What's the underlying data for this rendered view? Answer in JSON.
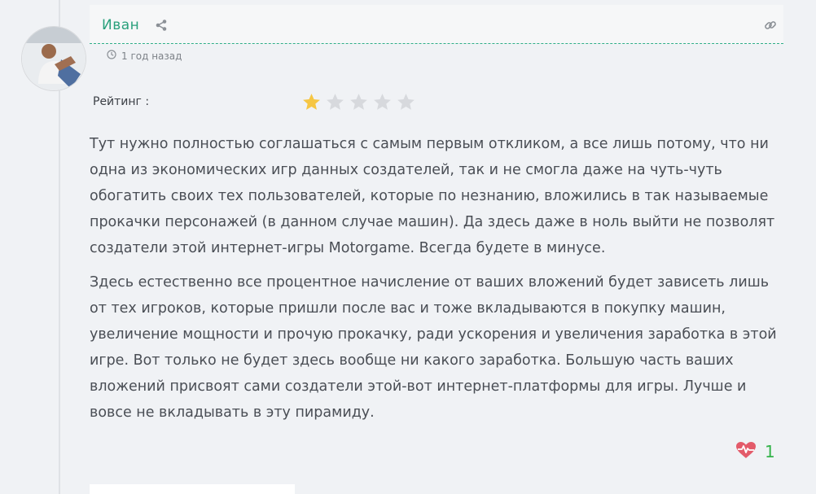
{
  "comment": {
    "author": "Иван",
    "time": "1 год назад",
    "rating_label": "Рейтинг :",
    "rating": 1,
    "rating_max": 5,
    "paragraphs": [
      "Тут нужно полностью соглашаться с самым первым откликом, а все лишь потому, что ни одна из экономических игр данных создателей, так и не смогла даже на чуть-чуть обогатить своих тех пользователей, которые по незнанию, вложились в так называемые прокачки персонажей (в данном случае машин). Да здесь даже в ноль выйти не позволят создатели этой интернет-игры Motorgame. Всегда будете в минусе.",
      "Здесь естественно все процентное начисление от ваших вложений будет зависеть лишь от тех игроков, которые пришли после вас и тоже вкладываются в покупку машин, увеличение мощности и прочую прокачку, ради ускорения и увеличения заработка в этой игре. Вот только не будет здесь вообще ни какого заработка. Большую часть ваших вложений присвоят сами создатели этой-вот интернет-платформы для игры. Лучше и вовсе не вкладывать в эту пирамиду."
    ],
    "likes": "1"
  },
  "icons": {
    "share": "share-icon",
    "link": "link-icon",
    "clock": "clock-icon",
    "star_filled": "star-filled-icon",
    "star_empty": "star-empty-icon",
    "heartbeat": "heartbeat-icon"
  },
  "colors": {
    "author": "#2aa07c",
    "star_filled": "#f6c643",
    "star_empty": "#d7d9dd",
    "heart": "#e35b6a",
    "likes": "#34b34a"
  }
}
